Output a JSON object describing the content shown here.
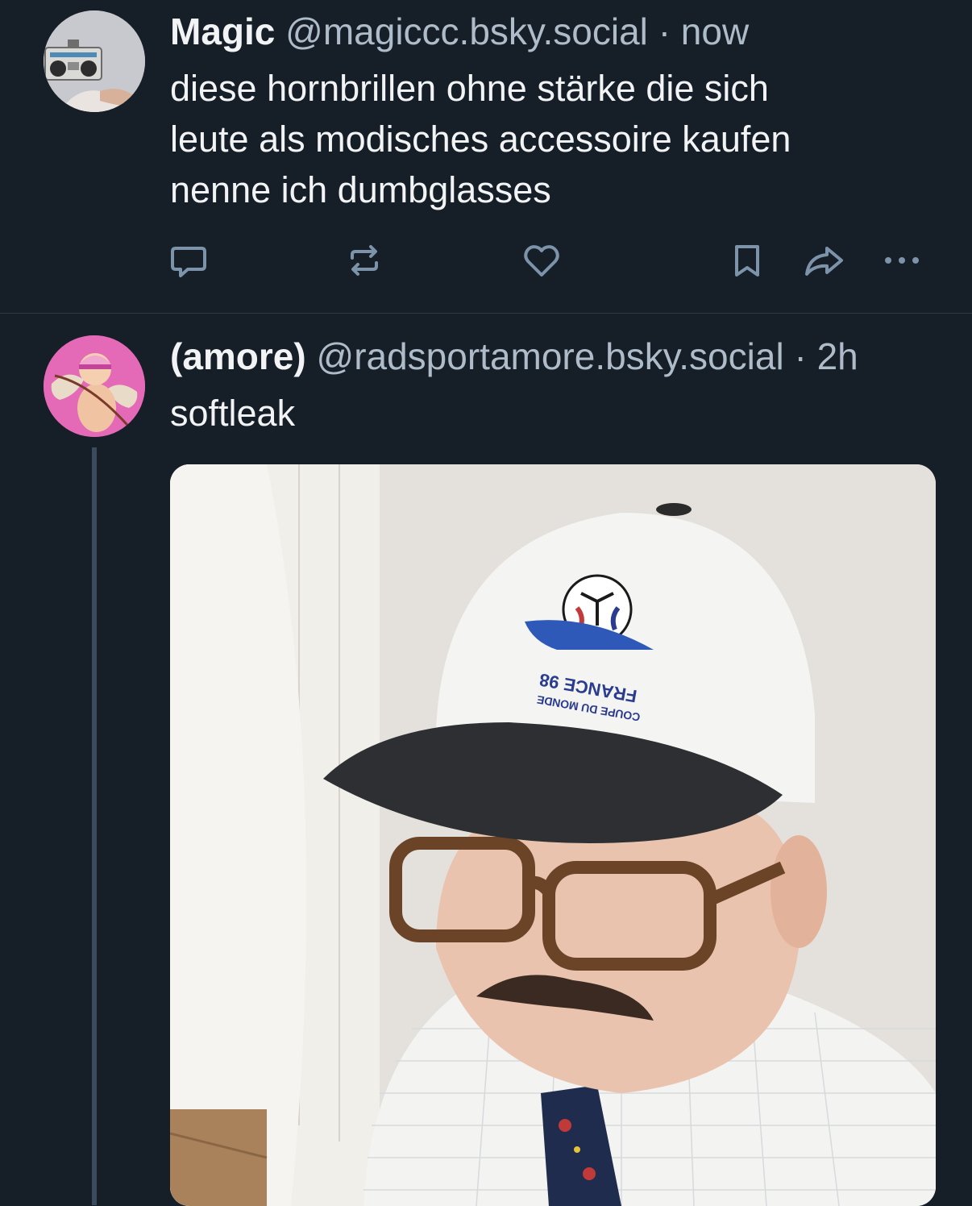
{
  "posts": [
    {
      "display_name": "Magic",
      "handle": "@magiccc.bsky.social",
      "separator": "·",
      "time": "now",
      "text_lines": [
        "diese hornbrillen ohne stärke die sich",
        "leute als modisches accessoire kaufen",
        "nenne ich dumbglasses"
      ],
      "actions": [
        "reply-icon",
        "repost-icon",
        "like-icon",
        "bookmark-icon",
        "share-icon",
        "more-icon"
      ]
    },
    {
      "display_name": "(amore)",
      "handle": "@radsportamore.bsky.social",
      "separator": "·",
      "time": "2h",
      "text_lines": [
        "softleak"
      ],
      "image": {
        "cap_logo_line1": "FRANCE 98",
        "cap_logo_line2": "COUPE DU MONDE"
      }
    }
  ],
  "colors": {
    "background": "#161e27",
    "text": "#f1f3f5",
    "muted": "#aebbc9",
    "icon": "#7c93a9",
    "divider": "#2e3a47",
    "thread_line": "#3b4a5c"
  }
}
